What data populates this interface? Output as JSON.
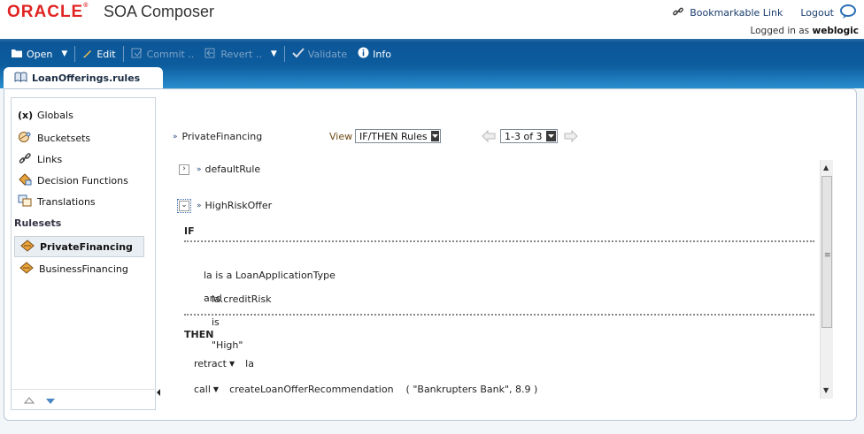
{
  "header": {
    "brand": "ORACLE",
    "registered": "®",
    "app_title": "SOA Composer",
    "bookmark_link": "Bookmarkable Link",
    "logout": "Logout",
    "logged_in_prefix": "Logged in as",
    "user": "weblogic"
  },
  "toolbar": {
    "open": "Open",
    "edit": "Edit",
    "commit": "Commit ..",
    "revert": "Revert ..",
    "validate": "Validate",
    "info": "Info"
  },
  "tab": {
    "label": "LoanOfferings.rules"
  },
  "sidebar": {
    "items": [
      {
        "label": "Globals",
        "icon": "variable-icon"
      },
      {
        "label": "Bucketsets",
        "icon": "bucketset-icon"
      },
      {
        "label": "Links",
        "icon": "link-icon"
      },
      {
        "label": "Decision Functions",
        "icon": "decision-function-icon"
      },
      {
        "label": "Translations",
        "icon": "translation-icon"
      }
    ],
    "rulesets_heading": "Rulesets",
    "rulesets": [
      {
        "label": "PrivateFinancing",
        "selected": true
      },
      {
        "label": "BusinessFinancing",
        "selected": false
      }
    ]
  },
  "content": {
    "ruleset_name": "PrivateFinancing",
    "view_label": "View",
    "view_value": "IF/THEN Rules",
    "pager_value": "1-3 of 3",
    "rules": [
      {
        "name": "defaultRule",
        "expanded": false
      },
      {
        "name": "HighRiskOffer",
        "expanded": true
      }
    ],
    "if_label": "IF",
    "conditions": {
      "line1_subject": "la is a LoanApplicationType",
      "line1_conj": "and",
      "line2_subject": "la.creditRisk",
      "line2_op": "is",
      "line2_value": "\"High\""
    },
    "then_label": "THEN",
    "actions": [
      {
        "verb": "retract",
        "target": "la"
      },
      {
        "verb": "call",
        "target": "createLoanOfferRecommendation",
        "args": "( \"Bankrupters Bank\", 8.9 )"
      }
    ]
  },
  "colors": {
    "brand_red": "#e02323",
    "toolbar_blue": "#0c5697",
    "link_blue": "#1b3e6e"
  }
}
